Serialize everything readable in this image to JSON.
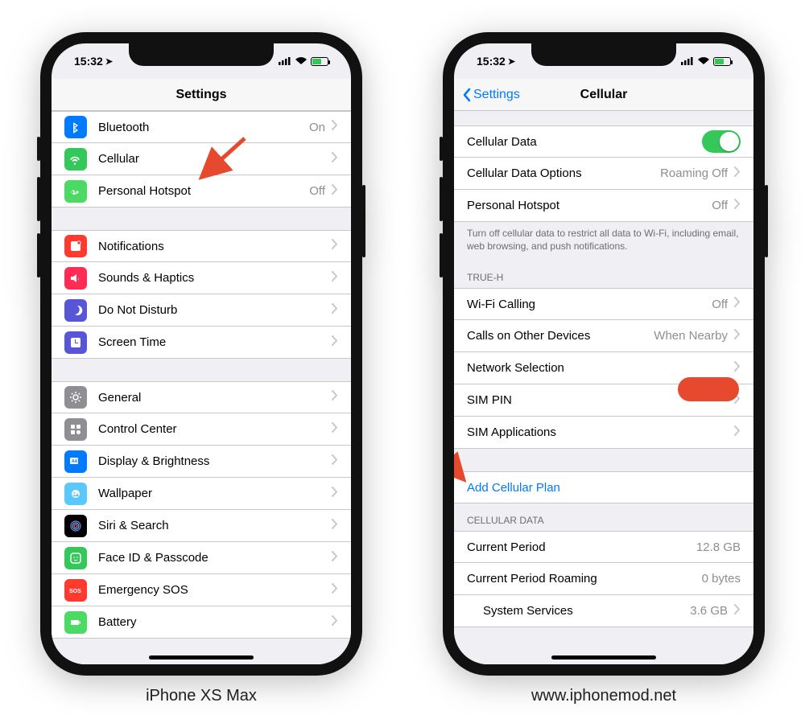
{
  "statusTime": "15:32",
  "batteryPct": 60,
  "captions": {
    "left": "iPhone XS Max",
    "right": "www.iphonemod.net"
  },
  "left": {
    "title": "Settings",
    "groups": [
      {
        "rows": [
          {
            "key": "bluetooth",
            "label": "Bluetooth",
            "value": "On",
            "chev": true,
            "iconBg": "ic-blue",
            "iconName": "bluetooth-icon",
            "svg": "<path fill='#fff' d='M6 3l6 4-4 3 4 3-6 4V3zm1.5 2.8v3L9.8 7 7.5 5.8zM7.5 11v3l2.3-1.5L7.5 11z'/>"
          },
          {
            "key": "cellular",
            "label": "Cellular",
            "value": "",
            "chev": true,
            "iconBg": "ic-green",
            "iconName": "cellular-icon",
            "svg": "<path fill='#fff' d='M2 9a7 7 0 0112 0l-1.5 1a5.2 5.2 0 00-9 0L2 9zm2.5 2a4 4 0 017 0l-1.5 1a2.2 2.2 0 00-4 0L4.5 11zM8 13.5a1.2 1.2 0 110 2.4 1.2 1.2 0 010-2.4z'/>"
          },
          {
            "key": "hotspot",
            "label": "Personal Hotspot",
            "value": "Off",
            "chev": true,
            "iconBg": "ic-lgreen",
            "iconName": "hotspot-icon",
            "svg": "<path fill='#fff' d='M5 7a3 3 0 012.8 4H10a3 3 0 11-2.8-4H5zm0 1.5A1.5 1.5 0 106.5 10 1.5 1.5 0 005 8.5zm6 0A1.5 1.5 0 1012.5 10 1.5 1.5 0 0011 8.5z'/>"
          }
        ]
      },
      {
        "rows": [
          {
            "key": "notifications",
            "label": "Notifications",
            "chev": true,
            "iconBg": "ic-red",
            "iconName": "notifications-icon",
            "svg": "<rect x='3' y='3' width='12' height='12' rx='2' fill='#fff'/><circle cx='13' cy='5' r='2.2' fill='#ff3b30' stroke='#fff'/>"
          },
          {
            "key": "sounds",
            "label": "Sounds & Haptics",
            "chev": true,
            "iconBg": "ic-pink",
            "iconName": "sounds-icon",
            "svg": "<path fill='#fff' d='M3 7h3l4-3v10l-4-3H3V7zm9 1a3 3 0 010 4v-1a2 2 0 000-2V8z'/>"
          },
          {
            "key": "dnd",
            "label": "Do Not Disturb",
            "chev": true,
            "iconBg": "ic-purple",
            "iconName": "moon-icon",
            "svg": "<path fill='#fff' d='M11 3a6 6 0 01-3 11A6 6 0 1011 3z'/>"
          },
          {
            "key": "screentime",
            "label": "Screen Time",
            "chev": true,
            "iconBg": "ic-sgpurple",
            "iconName": "screentime-icon",
            "svg": "<rect x='3' y='3' width='12' height='12' rx='2' fill='#fff'/><path fill='#5856d6' d='M9 5v4h3v1H8V5h1z'/>"
          }
        ]
      },
      {
        "rows": [
          {
            "key": "general",
            "label": "General",
            "chev": true,
            "iconBg": "ic-gray",
            "iconName": "gear-icon",
            "svg": "<circle cx='9' cy='9' r='3' fill='none' stroke='#fff' stroke-width='1.5'/><path stroke='#fff' stroke-width='1.5' d='M9 2v2M9 14v2M2 9h2M14 9h2M4 4l1.4 1.4M12.6 12.6L14 14M14 4l-1.4 1.4M5.4 12.6L4 14'/>"
          },
          {
            "key": "controlcenter",
            "label": "Control Center",
            "chev": true,
            "iconBg": "ic-gray",
            "iconName": "control-center-icon",
            "svg": "<rect x='3' y='3' width='5' height='5' rx='1' fill='#fff'/><rect x='10' y='3' width='5' height='5' rx='1' fill='#fff'/><rect x='3' y='10' width='5' height='5' rx='1' fill='#fff'/><circle cx='12.5' cy='12.5' r='2.5' fill='#fff'/>"
          },
          {
            "key": "display",
            "label": "Display & Brightness",
            "chev": true,
            "iconBg": "ic-blue",
            "iconName": "display-icon",
            "svg": "<rect x='2' y='4' width='10' height='8' rx='1' fill='#fff'/><text x='4' y='10' font-size='5' font-family='Arial' font-weight='bold' fill='#007aff'>AA</text>"
          },
          {
            "key": "wallpaper",
            "label": "Wallpaper",
            "chev": true,
            "iconBg": "ic-cyan",
            "iconName": "wallpaper-icon",
            "svg": "<circle cx='9' cy='9' r='5' fill='#fff'/><circle cx='7.5' cy='8' r='1' fill='#5ac8fa'/><path d='M5 12l2-2 2 1 2-3 2 4z' fill='#5ac8fa'/>"
          },
          {
            "key": "siri",
            "label": "Siri & Search",
            "chev": true,
            "iconBg": "ic-black",
            "iconName": "siri-icon",
            "svg": "<circle cx='9' cy='9' r='6' fill='none' stroke='#a26bf5' stroke-width='1.2'/><circle cx='9' cy='9' r='4' fill='none' stroke='#32d1e4' stroke-width='1.2'/><circle cx='9' cy='9' r='2' fill='none' stroke='#ff5ea0' stroke-width='1.2'/>"
          },
          {
            "key": "faceid",
            "label": "Face ID & Passcode",
            "chev": true,
            "iconBg": "ic-green",
            "iconName": "faceid-icon",
            "svg": "<rect x='3' y='3' width='12' height='12' rx='3' fill='none' stroke='#fff' stroke-width='1.5'/><circle cx='7' cy='8' r='0.8' fill='#fff'/><circle cx='11' cy='8' r='0.8' fill='#fff'/><path d='M7 11c1 1 3 1 4 0' stroke='#fff' fill='none'/>"
          },
          {
            "key": "sos",
            "label": "Emergency SOS",
            "chev": true,
            "iconBg": "ic-red",
            "iconName": "sos-icon",
            "svg": "<text x='1' y='12' font-size='7' font-family='Arial' font-weight='bold' fill='#fff'>SOS</text>"
          },
          {
            "key": "battery",
            "label": "Battery",
            "chev": true,
            "iconBg": "ic-green2",
            "iconName": "battery-icon",
            "svg": "<rect x='3' y='6' width='10' height='6' rx='1' fill='#fff'/><rect x='13.5' y='7.5' width='1.5' height='3' fill='#fff'/>"
          }
        ]
      }
    ]
  },
  "right": {
    "title": "Cellular",
    "back": "Settings",
    "groups": [
      {
        "rows": [
          {
            "key": "cellulardata",
            "label": "Cellular Data",
            "toggle": true,
            "on": true
          },
          {
            "key": "dataoptions",
            "label": "Cellular Data Options",
            "value": "Roaming Off",
            "chev": true
          },
          {
            "key": "r-hotspot",
            "label": "Personal Hotspot",
            "value": "Off",
            "chev": true
          }
        ],
        "footer": "Turn off cellular data to restrict all data to Wi-Fi, including email, web browsing, and push notifications."
      },
      {
        "header": "TRUE-H",
        "rows": [
          {
            "key": "wificalling",
            "label": "Wi-Fi Calling",
            "value": "Off",
            "chev": true
          },
          {
            "key": "callsother",
            "label": "Calls on Other Devices",
            "value": "When Nearby",
            "chev": true
          },
          {
            "key": "network",
            "label": "Network Selection",
            "chev": true
          },
          {
            "key": "simpin",
            "label": "SIM PIN",
            "chev": true
          },
          {
            "key": "simapps",
            "label": "SIM Applications",
            "chev": true
          }
        ]
      },
      {
        "rows": [
          {
            "key": "addplan",
            "label": "Add Cellular Plan",
            "link": true
          }
        ]
      },
      {
        "header": "CELLULAR DATA",
        "rows": [
          {
            "key": "currentperiod",
            "label": "Current Period",
            "value": "12.8 GB"
          },
          {
            "key": "roamingperiod",
            "label": "Current Period Roaming",
            "value": "0 bytes"
          },
          {
            "key": "systemservices",
            "label": "System Services",
            "value": "3.6 GB",
            "chev": true,
            "indent": true
          }
        ]
      }
    ]
  }
}
